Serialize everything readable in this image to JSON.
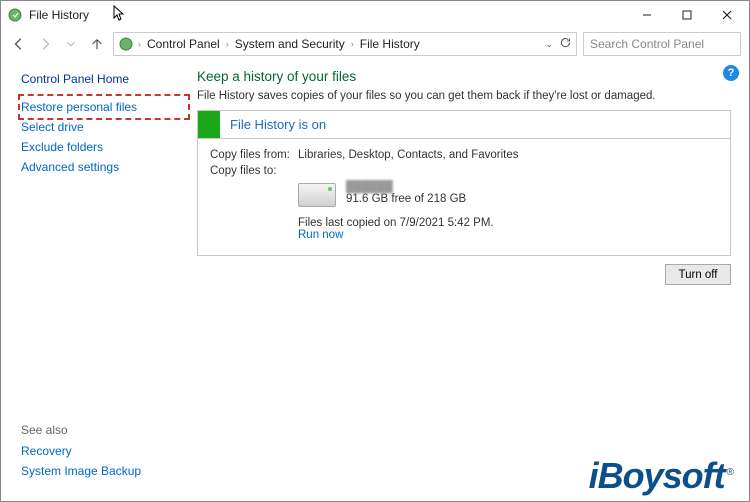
{
  "window": {
    "title": "File History"
  },
  "breadcrumbs": {
    "items": [
      "Control Panel",
      "System and Security",
      "File History"
    ]
  },
  "search": {
    "placeholder": "Search Control Panel"
  },
  "sidebar": {
    "home": "Control Panel Home",
    "links": {
      "restore": "Restore personal files",
      "select_drive": "Select drive",
      "exclude": "Exclude folders",
      "advanced": "Advanced settings"
    },
    "see_also": {
      "label": "See also",
      "recovery": "Recovery",
      "system_image_backup": "System Image Backup"
    }
  },
  "main": {
    "heading": "Keep a history of your files",
    "subtext": "File History saves copies of your files so you can get them back if they're lost or damaged.",
    "status_title": "File History is on",
    "copy_from_label": "Copy files from:",
    "copy_from_value": "Libraries, Desktop, Contacts, and Favorites",
    "copy_to_label": "Copy files to:",
    "drive_name": "██████",
    "drive_free": "91.6 GB free of 218 GB",
    "last_copied": "Files last copied on 7/9/2021 5:42 PM.",
    "run_now": "Run now",
    "turn_off": "Turn off"
  },
  "watermark": "iBoysoft"
}
